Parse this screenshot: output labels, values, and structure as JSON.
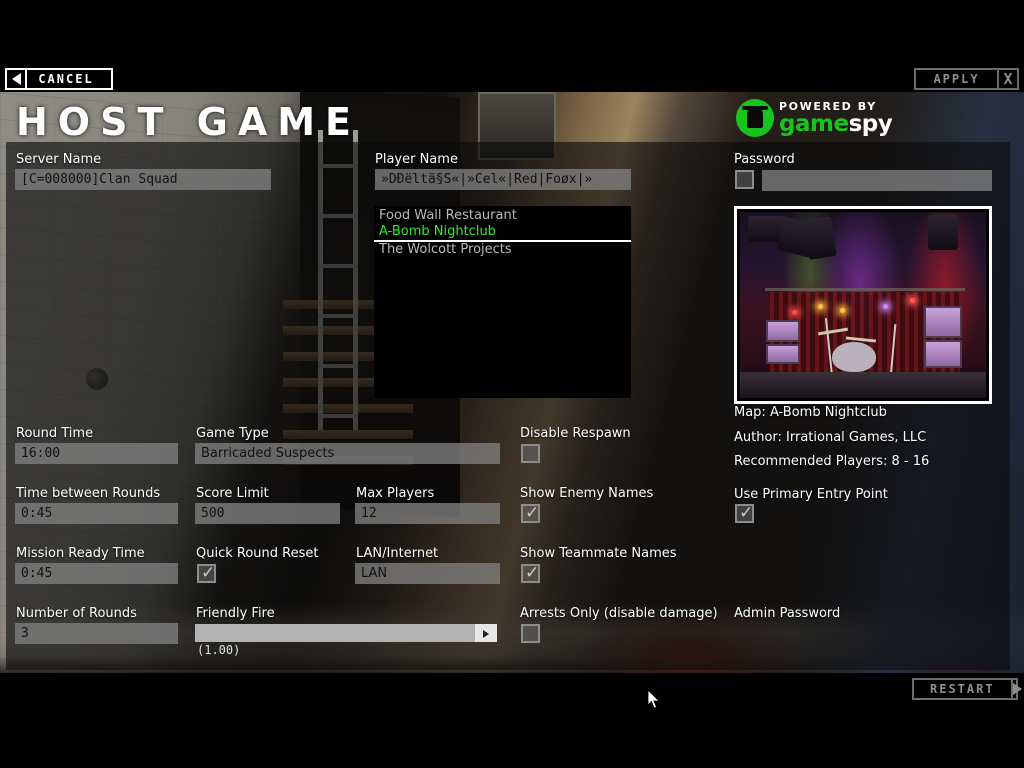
{
  "window": {
    "title": "HOST GAME"
  },
  "topbar": {
    "cancel_label": "CANCEL",
    "apply_label": "APPLY",
    "close_glyph": "X",
    "back_arrow_icon": "triangle-left-icon",
    "apply_arrow_icon": "x-close-icon"
  },
  "bottombar": {
    "restart_label": "RESTART",
    "restart_arrow_icon": "triangle-right-icon"
  },
  "branding": {
    "powered_by": "POWERED BY",
    "game": "game",
    "spy": "spy",
    "green": "#18c31d"
  },
  "server": {
    "name_label": "Server Name",
    "name_value": "[C=008000]Clan Squad",
    "player_label": "Player Name",
    "player_value": "»DĐëltä§S«|»Cel«|Red|Foøx|»",
    "password_label": "Password",
    "password_value": "",
    "password_checkbox_checked": false
  },
  "maplist": {
    "items": [
      {
        "label": "Food Wall Restaurant",
        "selected": false
      },
      {
        "label": "A-Bomb Nightclub",
        "selected": true
      },
      {
        "label": "The Wolcott Projects",
        "selected": false
      }
    ],
    "selected_color": "#2aee2a"
  },
  "mapinfo": {
    "map": "Map: A-Bomb Nightclub",
    "author": "Author: Irrational Games, LLC",
    "recommended": "Recommended Players: 8 - 16",
    "entry_point_label": "Use Primary Entry Point",
    "entry_point_checked": true,
    "preview_alt": "nightclub-stage-preview"
  },
  "settings": {
    "round_time": {
      "label": "Round Time",
      "value": "16:00"
    },
    "game_type": {
      "label": "Game Type",
      "value": "Barricaded Suspects"
    },
    "time_between_rounds": {
      "label": "Time between Rounds",
      "value": "0:45"
    },
    "score_limit": {
      "label": "Score Limit",
      "value": "500"
    },
    "max_players": {
      "label": "Max Players",
      "value": "12"
    },
    "mission_ready_time": {
      "label": "Mission Ready Time",
      "value": "0:45"
    },
    "quick_round_reset": {
      "label": "Quick Round Reset",
      "checked": true
    },
    "lan_internet": {
      "label": "LAN/Internet",
      "value": "LAN"
    },
    "number_of_rounds": {
      "label": "Number of Rounds",
      "value": "3"
    },
    "friendly_fire": {
      "label": "Friendly Fire",
      "value": "(1.00)"
    },
    "disable_respawn": {
      "label": "Disable Respawn",
      "checked": false
    },
    "show_enemy_names": {
      "label": "Show Enemy Names",
      "checked": true
    },
    "show_teammate_names": {
      "label": "Show Teammate Names",
      "checked": true
    },
    "arrests_only": {
      "label": "Arrests Only (disable damage)",
      "checked": false
    },
    "admin_password": {
      "label": "Admin Password",
      "value": ""
    }
  }
}
